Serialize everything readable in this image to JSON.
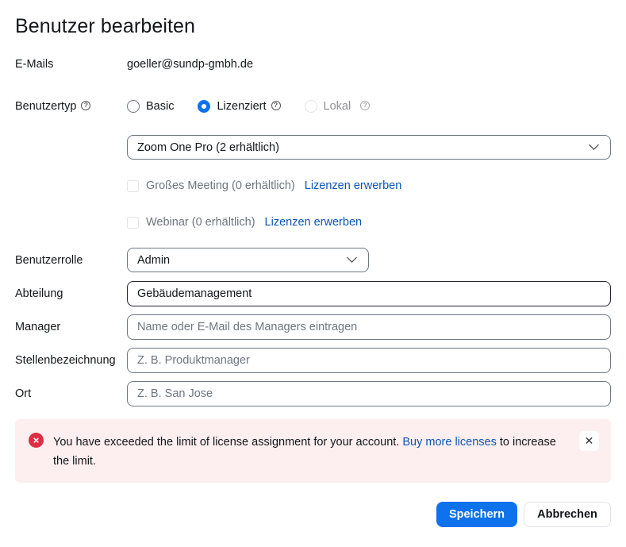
{
  "dialog": {
    "title": "Benutzer bearbeiten"
  },
  "fields": {
    "emails_label": "E-Mails",
    "emails_value": "goeller@sundp-gmbh.de",
    "user_type_label": "Benutzertyp",
    "user_type_help_icon": "question-circle-icon",
    "user_type_options": [
      {
        "label": "Basic",
        "checked": false,
        "disabled": false
      },
      {
        "label": "Lizenziert",
        "checked": true,
        "disabled": false
      },
      {
        "label": "Lokal",
        "checked": false,
        "disabled": true
      }
    ],
    "license_select_value": "Zoom One Pro (2 erhältlich)",
    "addons": [
      {
        "label": "Großes Meeting (0 erhältlich)",
        "link": "Lizenzen erwerben",
        "checked": false,
        "disabled": true
      },
      {
        "label": "Webinar (0 erhältlich)",
        "link": "Lizenzen erwerben",
        "checked": false,
        "disabled": true
      }
    ],
    "role_label": "Benutzerrolle",
    "role_value": "Admin",
    "department_label": "Abteilung",
    "department_value": "Gebäudemanagement",
    "manager_label": "Manager",
    "manager_placeholder": "Name oder E-Mail des Managers eintragen",
    "job_title_label": "Stellenbezeichnung",
    "job_title_placeholder": "Z. B. Produktmanager",
    "location_label": "Ort",
    "location_placeholder": "Z. B. San Jose"
  },
  "alert": {
    "text_before": "You have exceeded the limit of license assignment for your account.",
    "link": "Buy more licenses",
    "text_after": "to increase the limit.",
    "icon": "error-x-icon",
    "close_icon": "close-icon",
    "color": "#de2e44"
  },
  "actions": {
    "save_label": "Speichern",
    "cancel_label": "Abbrechen"
  },
  "colors": {
    "accent": "#0e72ed",
    "link": "#0956b5",
    "alert_bg": "#fdeef0"
  }
}
